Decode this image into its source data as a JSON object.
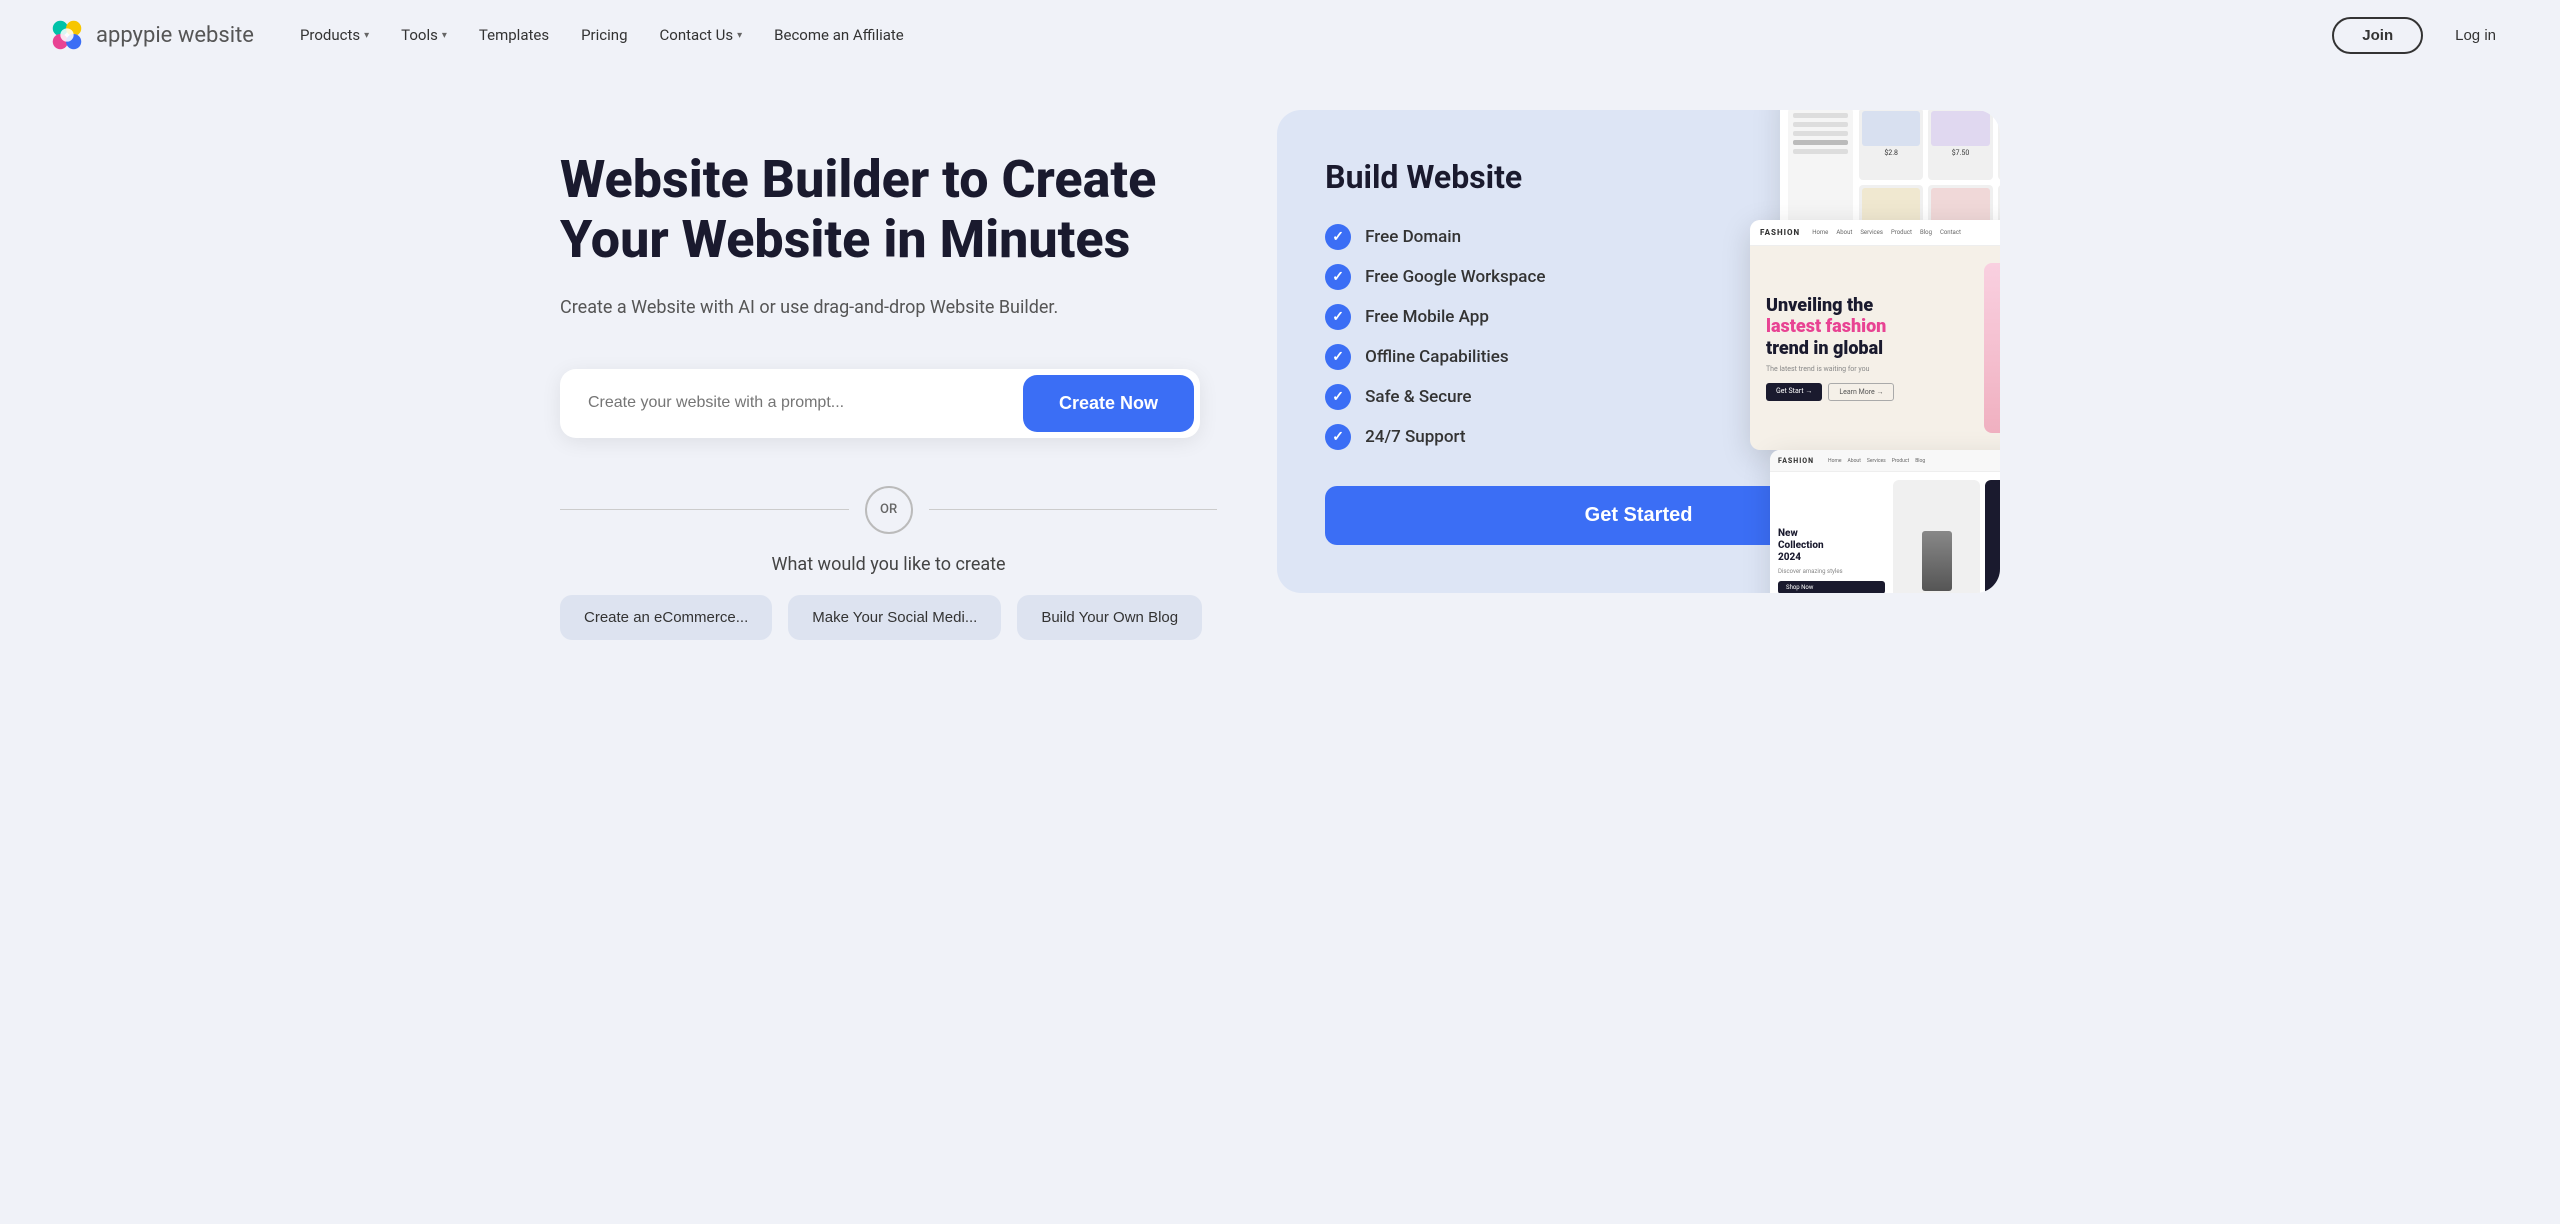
{
  "brand": {
    "name": "appypie",
    "name_suffix": "website"
  },
  "nav": {
    "items": [
      {
        "label": "Products",
        "hasDropdown": true
      },
      {
        "label": "Tools",
        "hasDropdown": true
      },
      {
        "label": "Templates",
        "hasDropdown": false
      },
      {
        "label": "Pricing",
        "hasDropdown": false
      },
      {
        "label": "Contact Us",
        "hasDropdown": true
      },
      {
        "label": "Become an Affiliate",
        "hasDropdown": false
      }
    ],
    "join_label": "Join",
    "login_label": "Log in"
  },
  "hero": {
    "title": "Website Builder to Create Your Website in Minutes",
    "subtitle": "Create a Website with AI or use drag-and-drop Website Builder.",
    "search_placeholder": "Create your website with a prompt...",
    "create_button": "Create Now",
    "or_label": "OR",
    "what_create_label": "What would you like to create",
    "chips": [
      {
        "label": "Create an eCommerce..."
      },
      {
        "label": "Make Your Social Medi..."
      },
      {
        "label": "Build Your Own Blog"
      }
    ]
  },
  "build_card": {
    "title": "Build Website",
    "features": [
      "Free Domain",
      "Free Google Workspace",
      "Free Mobile App",
      "Offline Capabilities",
      "Safe & Secure",
      "24/7 Support"
    ],
    "get_started_label": "Get Started"
  },
  "colors": {
    "primary": "#3b6ef5",
    "bg": "#f0f2f8",
    "card_bg": "#dde5f5",
    "chip_bg": "#dde3f0",
    "text_dark": "#1a1a2e",
    "text_mid": "#555",
    "pink_accent": "#e84393"
  }
}
